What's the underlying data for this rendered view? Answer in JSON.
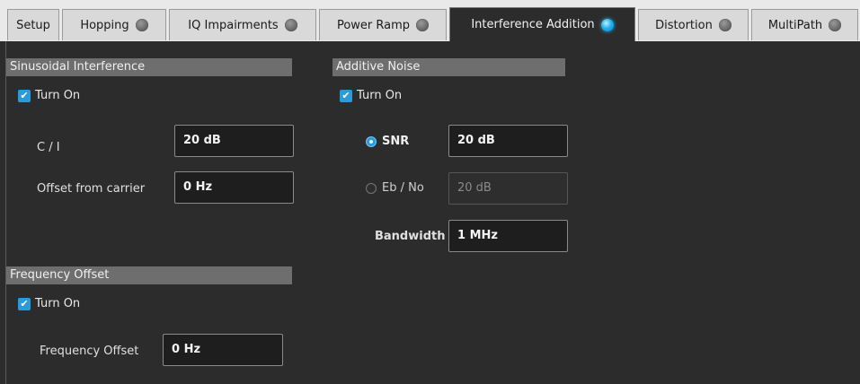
{
  "tabs": [
    {
      "label": "Setup",
      "led": false,
      "active": false
    },
    {
      "label": "Hopping",
      "led": true,
      "active": false
    },
    {
      "label": "IQ Impairments",
      "led": true,
      "active": false
    },
    {
      "label": "Power Ramp",
      "led": true,
      "active": false
    },
    {
      "label": "Interference Addition",
      "led": true,
      "active": true
    },
    {
      "label": "Distortion",
      "led": true,
      "active": false
    },
    {
      "label": "MultiPath",
      "led": true,
      "active": false
    }
  ],
  "sinusoidal": {
    "header": "Sinusoidal Interference",
    "turn_on_label": "Turn On",
    "turn_on_checked": true,
    "ci_label": "C / I",
    "ci_value": "20 dB",
    "offset_label": "Offset from carrier",
    "offset_value": "0 Hz"
  },
  "additive_noise": {
    "header": "Additive Noise",
    "turn_on_label": "Turn On",
    "turn_on_checked": true,
    "snr_label": "SNR",
    "snr_value": "20 dB",
    "snr_selected": true,
    "ebno_label": "Eb / No",
    "ebno_value": "20 dB",
    "bandwidth_label": "Bandwidth",
    "bandwidth_value": "1 MHz"
  },
  "frequency_offset": {
    "header": "Frequency Offset",
    "turn_on_label": "Turn On",
    "turn_on_checked": true,
    "freq_label": "Frequency Offset",
    "freq_value": "0 Hz"
  },
  "colors": {
    "accent": "#2a9ad9",
    "led_active": "#24b6f2",
    "led_inactive": "#6d6d6d",
    "panel_bg": "#2c2c2c",
    "section_header_bg": "#6e6e6e"
  }
}
